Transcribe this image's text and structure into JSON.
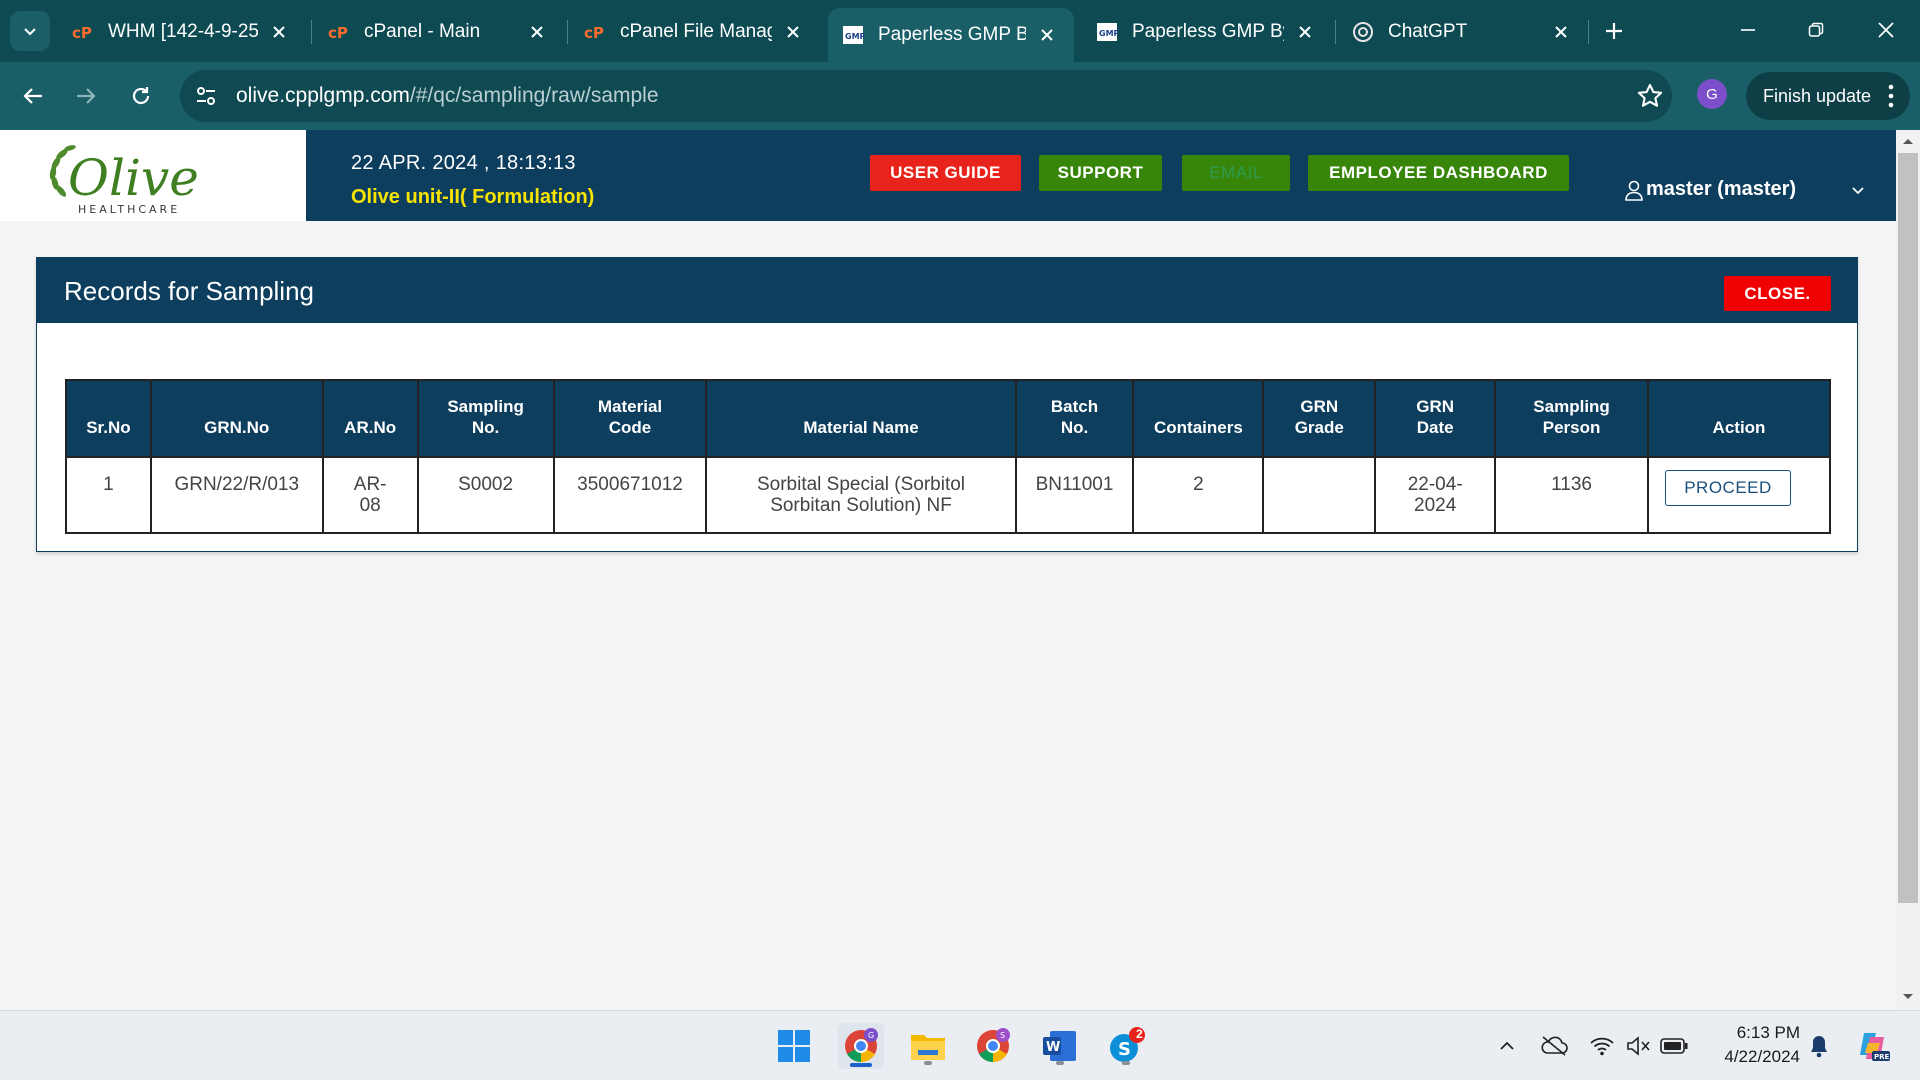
{
  "browser": {
    "tabs": [
      {
        "title": "WHM [142-4-9-25]",
        "icon": "cpanel-icon"
      },
      {
        "title": "cPanel - Main",
        "icon": "cpanel-icon"
      },
      {
        "title": "cPanel File Manager",
        "icon": "cpanel-icon"
      },
      {
        "title": "Paperless GMP By",
        "icon": "gmp-icon",
        "active": true
      },
      {
        "title": "Paperless GMP By",
        "icon": "gmp-icon"
      },
      {
        "title": "ChatGPT",
        "icon": "chatgpt-icon"
      }
    ],
    "url_host": "olive.cpplgmp.com",
    "url_path": "/#/qc/sampling/raw/sample",
    "profile_letter": "G",
    "finish_update_label": "Finish update"
  },
  "header": {
    "logo_text": "Olive",
    "logo_subtext": "HEALTHCARE",
    "datetime": "22 APR. 2024 , 18:13:13",
    "unit": "Olive unit-II( Formulation)",
    "buttons": {
      "user_guide": "USER GUIDE",
      "support": "SUPPORT",
      "email": "EMAIL",
      "employee_dashboard": "EMPLOYEE DASHBOARD"
    },
    "user": "master (master)"
  },
  "panel": {
    "title": "Records for Sampling",
    "close_label": "CLOSE.",
    "columns": [
      "Sr.No",
      "GRN.No",
      "AR.No",
      "Sampling No.",
      "Material Code",
      "Material Name",
      "Batch No.",
      "Containers",
      "GRN Grade",
      "GRN Date",
      "Sampling Person",
      "Action"
    ],
    "rows": [
      {
        "sr_no": "1",
        "grn_no": "GRN/22/R/013",
        "ar_no": "AR-08",
        "sampling_no": "S0002",
        "material_code": "3500671012",
        "material_name": "Sorbital Special (Sorbitol Sorbitan Solution) NF",
        "batch_no": "BN11001",
        "containers": "2",
        "grn_grade": "",
        "grn_date": "22-04-2024",
        "sampling_person": "1136",
        "action_label": "PROCEED"
      }
    ]
  },
  "taskbar": {
    "apps": [
      "windows-start-icon",
      "chrome-icon",
      "file-explorer-icon",
      "chrome-profile-icon",
      "word-icon",
      "skype-icon"
    ],
    "skype_badge": "2",
    "time": "6:13 PM",
    "date": "4/22/2024"
  },
  "colors": {
    "tab_strip": "#0d4a52",
    "toolbar": "#1a5f68",
    "app_header": "#0e3e5e",
    "unit_text": "#f6e300",
    "red_button": "#e8231b",
    "green_button": "#37860a",
    "close_button": "#f00000"
  }
}
